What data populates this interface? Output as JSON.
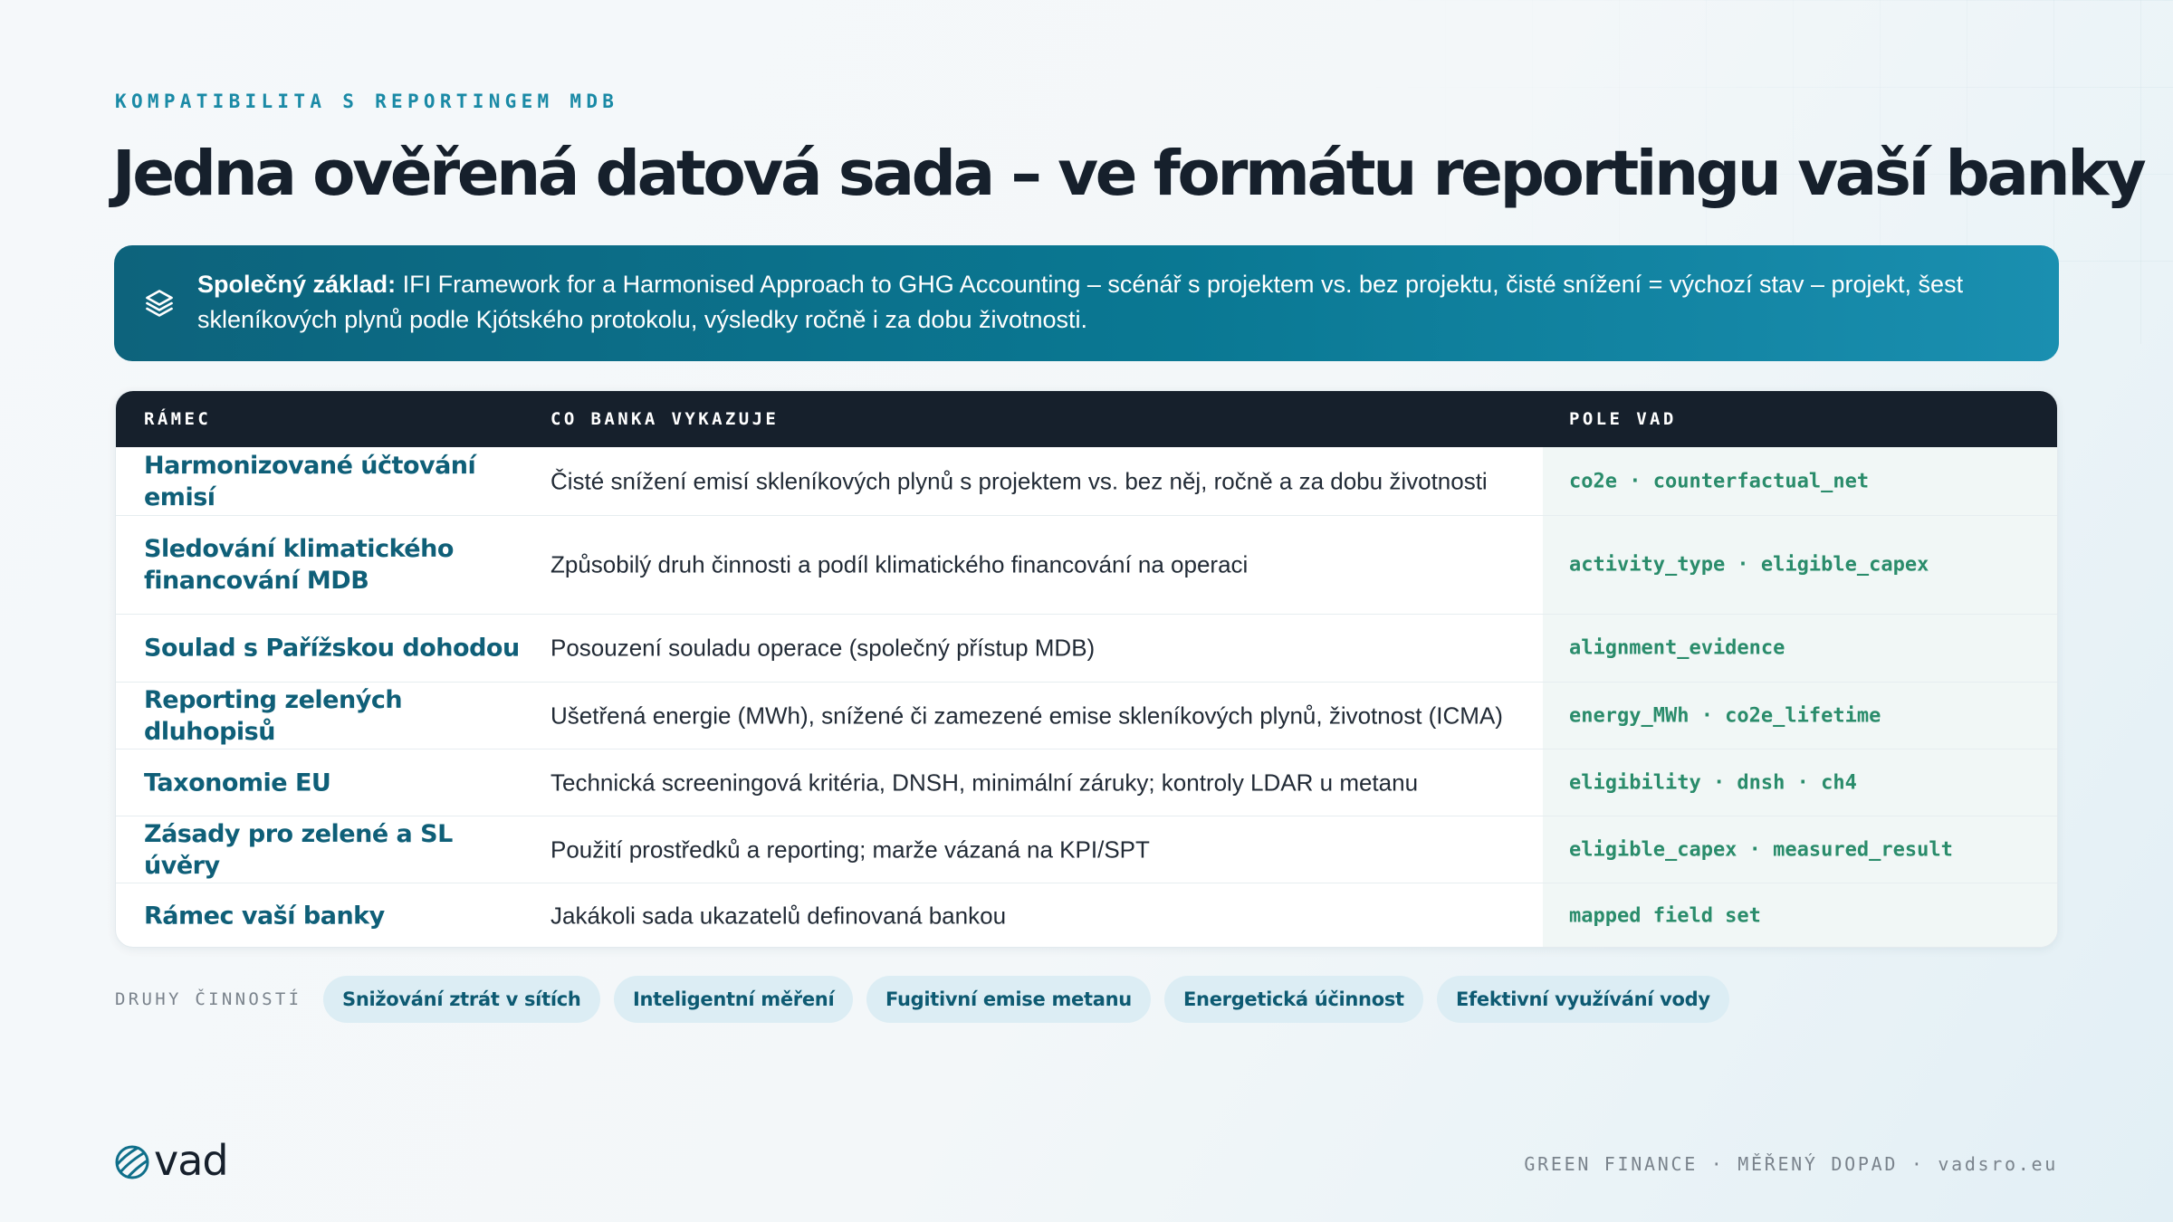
{
  "header": {
    "eyebrow": "KOMPATIBILITA S REPORTINGEM MDB",
    "title": "Jedna ověřená datová sada – ve formátu reportingu vaší banky"
  },
  "callout": {
    "icon": "layers-icon",
    "lead": "Společný základ:",
    "text": " IFI Framework for a Harmonised Approach to GHG Accounting – scénář s projektem vs. bez projektu, čisté snížení = výchozí stav – projekt, šest skleníkových plynů podle Kjótského protokolu, výsledky ročně i za dobu životnosti."
  },
  "table": {
    "headers": [
      "RÁMEC",
      "CO BANKA VYKAZUJE",
      "POLE VAD"
    ],
    "rows": [
      {
        "name": "Harmonizované účtování emisí",
        "desc": "Čisté snížení emisí skleníkových plynů s projektem vs. bez něj, ročně a za dobu životnosti",
        "fields": "co2e · counterfactual_net"
      },
      {
        "name": "Sledování klimatického financování MDB",
        "desc": "Způsobilý druh činnosti a podíl klimatického financování na operaci",
        "fields": "activity_type · eligible_capex"
      },
      {
        "name": "Soulad s Pařížskou dohodou",
        "desc": "Posouzení souladu operace (společný přístup MDB)",
        "fields": "alignment_evidence"
      },
      {
        "name": "Reporting zelených dluhopisů",
        "desc": "Ušetřená energie (MWh), snížené či zamezené emise skleníkových plynů, životnost (ICMA)",
        "fields": "energy_MWh · co2e_lifetime"
      },
      {
        "name": "Taxonomie EU",
        "desc": "Technická screeningová kritéria, DNSH, minimální záruky; kontroly LDAR u metanu",
        "fields": "eligibility · dnsh · ch4"
      },
      {
        "name": "Zásady pro zelené a SL úvěry",
        "desc": "Použití prostředků a reporting; marže vázaná na KPI/SPT",
        "fields": "eligible_capex · measured_result"
      },
      {
        "name": "Rámec vaší banky",
        "desc": "Jakákoli sada ukazatelů definovaná bankou",
        "fields": "mapped field set"
      }
    ]
  },
  "activities": {
    "label": "DRUHY ČINNOSTÍ",
    "chips": [
      "Snižování ztrát v sítích",
      "Inteligentní měření",
      "Fugitivní emise metanu",
      "Energetická účinnost",
      "Efektivní využívání vody"
    ]
  },
  "footer": {
    "logo_text": "vad",
    "tagline": "GREEN FINANCE · MĚŘENÝ DOPAD · vadsro.eu"
  },
  "colors": {
    "accent": "#1a8aa6",
    "callout_bg": "#0a7893",
    "table_header_bg": "#16202c",
    "framework_name": "#0f5f78",
    "field_text": "#2a8c6b",
    "chip_bg": "#dcedf4"
  }
}
